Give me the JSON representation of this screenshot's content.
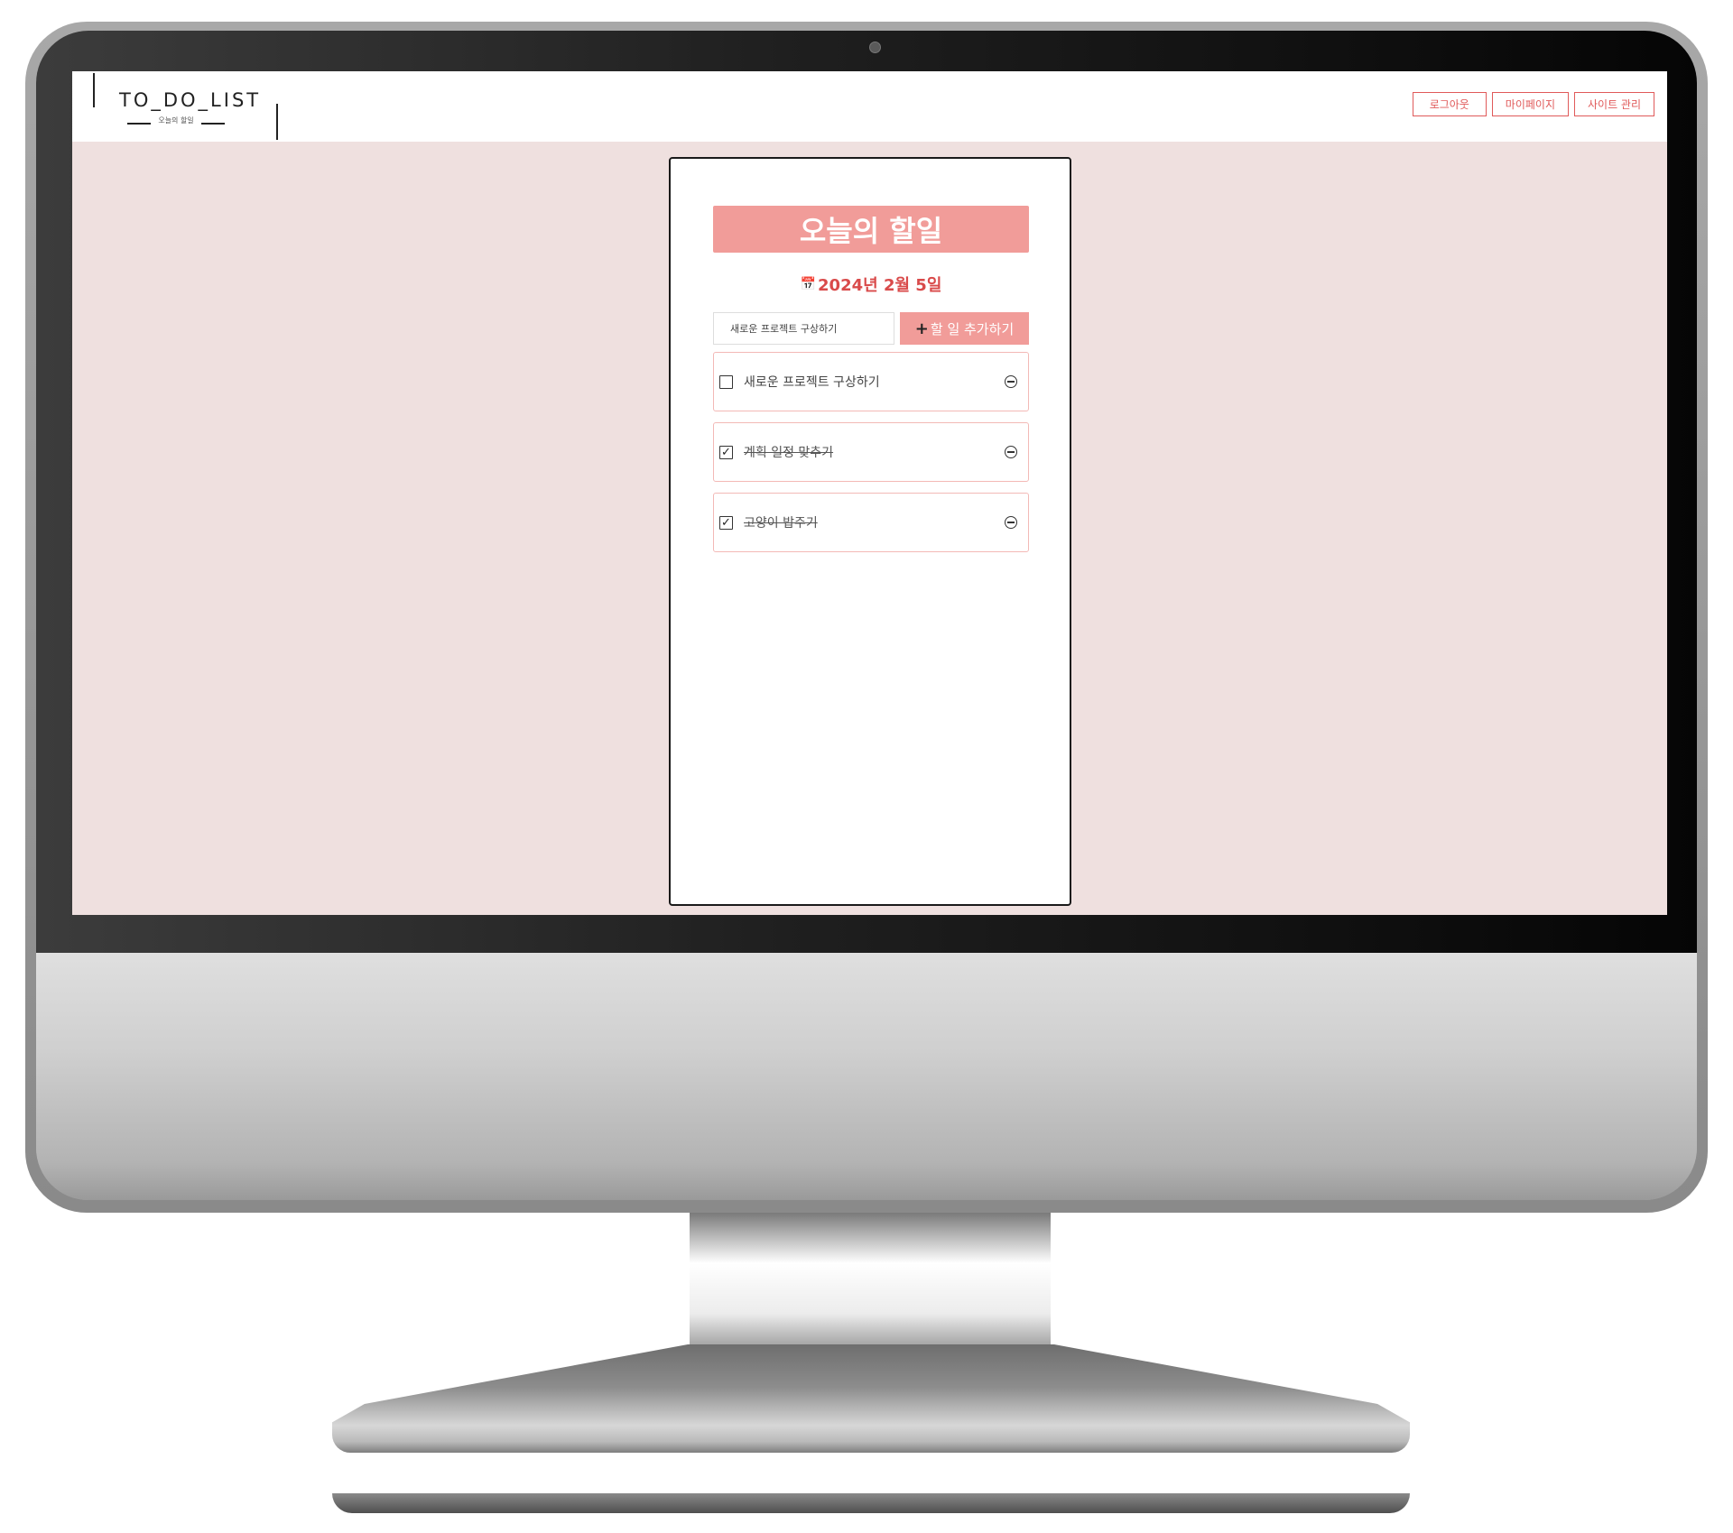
{
  "header": {
    "logo_title": "TO_DO_LIST",
    "logo_subtitle": "오늘의 할일",
    "nav": [
      "로그아웃",
      "마이페이지",
      "사이트 관리"
    ]
  },
  "card": {
    "title": "오늘의 할일",
    "date": "2024년 2월 5일",
    "input_value": "새로운 프로젝트 구상하기",
    "add_button_label": "할 일 추가하기",
    "todos": [
      {
        "text": "새로운 프로젝트 구상하기",
        "done": false
      },
      {
        "text": "계획 일정 맞추기",
        "done": true
      },
      {
        "text": "고양이 밥주기",
        "done": true
      }
    ]
  },
  "colors": {
    "accent": "#f19c99",
    "date_red": "#d94a4a",
    "background": "#efe0df"
  }
}
